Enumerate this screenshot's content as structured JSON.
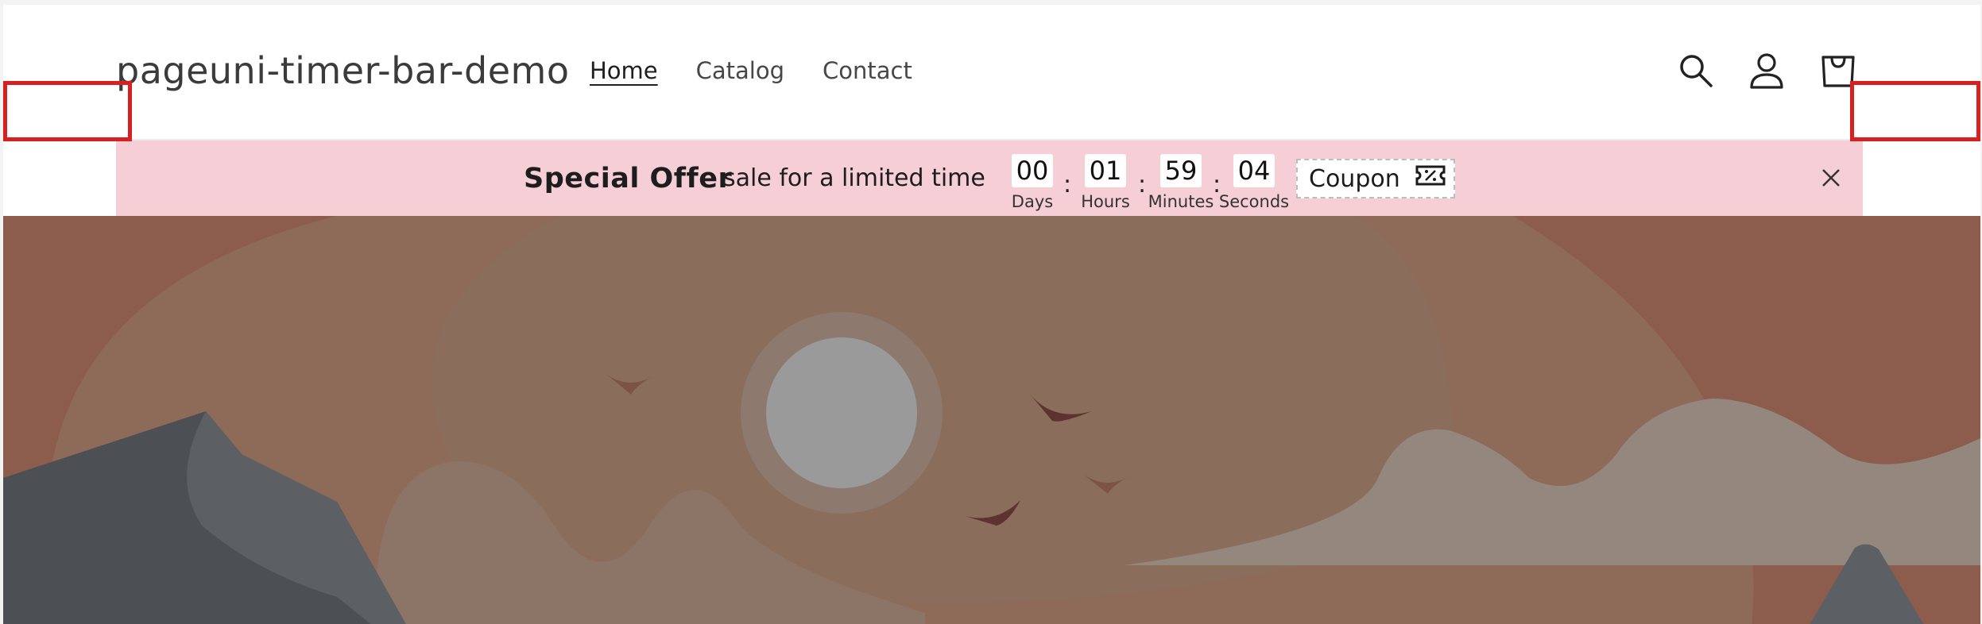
{
  "header": {
    "brand": "pageuni-timer-bar-demo",
    "nav": [
      {
        "label": "Home",
        "active": true
      },
      {
        "label": "Catalog",
        "active": false
      },
      {
        "label": "Contact",
        "active": false
      }
    ],
    "icons": [
      "search-icon",
      "account-icon",
      "cart-icon"
    ]
  },
  "timer_bar": {
    "title": "Special Offer",
    "subtitle": "sale for a limited time",
    "days": "00",
    "days_label": "Days",
    "hours": "01",
    "hours_label": "Hours",
    "minutes": "59",
    "minutes_label": "Minutes",
    "seconds": "04",
    "seconds_label": "Seconds",
    "separator": ":",
    "coupon_label": "Coupon",
    "background": "#f6ced6"
  },
  "colors": {
    "highlight_box": "#d91f1f",
    "hero_background": "#8c5c4c"
  }
}
